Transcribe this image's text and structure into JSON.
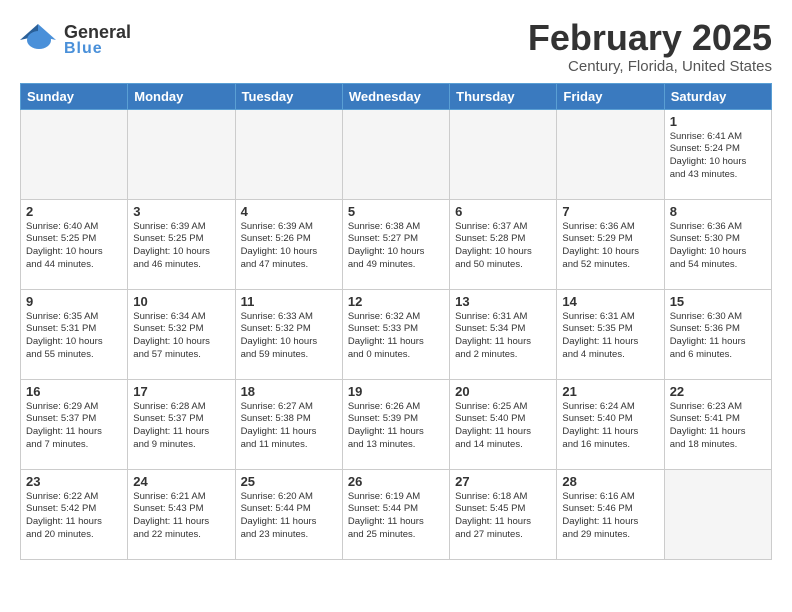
{
  "header": {
    "logo_general": "General",
    "logo_blue": "Blue",
    "month_title": "February 2025",
    "location": "Century, Florida, United States"
  },
  "days_of_week": [
    "Sunday",
    "Monday",
    "Tuesday",
    "Wednesday",
    "Thursday",
    "Friday",
    "Saturday"
  ],
  "weeks": [
    [
      {
        "day": "",
        "info": ""
      },
      {
        "day": "",
        "info": ""
      },
      {
        "day": "",
        "info": ""
      },
      {
        "day": "",
        "info": ""
      },
      {
        "day": "",
        "info": ""
      },
      {
        "day": "",
        "info": ""
      },
      {
        "day": "1",
        "info": "Sunrise: 6:41 AM\nSunset: 5:24 PM\nDaylight: 10 hours\nand 43 minutes."
      }
    ],
    [
      {
        "day": "2",
        "info": "Sunrise: 6:40 AM\nSunset: 5:25 PM\nDaylight: 10 hours\nand 44 minutes."
      },
      {
        "day": "3",
        "info": "Sunrise: 6:39 AM\nSunset: 5:25 PM\nDaylight: 10 hours\nand 46 minutes."
      },
      {
        "day": "4",
        "info": "Sunrise: 6:39 AM\nSunset: 5:26 PM\nDaylight: 10 hours\nand 47 minutes."
      },
      {
        "day": "5",
        "info": "Sunrise: 6:38 AM\nSunset: 5:27 PM\nDaylight: 10 hours\nand 49 minutes."
      },
      {
        "day": "6",
        "info": "Sunrise: 6:37 AM\nSunset: 5:28 PM\nDaylight: 10 hours\nand 50 minutes."
      },
      {
        "day": "7",
        "info": "Sunrise: 6:36 AM\nSunset: 5:29 PM\nDaylight: 10 hours\nand 52 minutes."
      },
      {
        "day": "8",
        "info": "Sunrise: 6:36 AM\nSunset: 5:30 PM\nDaylight: 10 hours\nand 54 minutes."
      }
    ],
    [
      {
        "day": "9",
        "info": "Sunrise: 6:35 AM\nSunset: 5:31 PM\nDaylight: 10 hours\nand 55 minutes."
      },
      {
        "day": "10",
        "info": "Sunrise: 6:34 AM\nSunset: 5:32 PM\nDaylight: 10 hours\nand 57 minutes."
      },
      {
        "day": "11",
        "info": "Sunrise: 6:33 AM\nSunset: 5:32 PM\nDaylight: 10 hours\nand 59 minutes."
      },
      {
        "day": "12",
        "info": "Sunrise: 6:32 AM\nSunset: 5:33 PM\nDaylight: 11 hours\nand 0 minutes."
      },
      {
        "day": "13",
        "info": "Sunrise: 6:31 AM\nSunset: 5:34 PM\nDaylight: 11 hours\nand 2 minutes."
      },
      {
        "day": "14",
        "info": "Sunrise: 6:31 AM\nSunset: 5:35 PM\nDaylight: 11 hours\nand 4 minutes."
      },
      {
        "day": "15",
        "info": "Sunrise: 6:30 AM\nSunset: 5:36 PM\nDaylight: 11 hours\nand 6 minutes."
      }
    ],
    [
      {
        "day": "16",
        "info": "Sunrise: 6:29 AM\nSunset: 5:37 PM\nDaylight: 11 hours\nand 7 minutes."
      },
      {
        "day": "17",
        "info": "Sunrise: 6:28 AM\nSunset: 5:37 PM\nDaylight: 11 hours\nand 9 minutes."
      },
      {
        "day": "18",
        "info": "Sunrise: 6:27 AM\nSunset: 5:38 PM\nDaylight: 11 hours\nand 11 minutes."
      },
      {
        "day": "19",
        "info": "Sunrise: 6:26 AM\nSunset: 5:39 PM\nDaylight: 11 hours\nand 13 minutes."
      },
      {
        "day": "20",
        "info": "Sunrise: 6:25 AM\nSunset: 5:40 PM\nDaylight: 11 hours\nand 14 minutes."
      },
      {
        "day": "21",
        "info": "Sunrise: 6:24 AM\nSunset: 5:40 PM\nDaylight: 11 hours\nand 16 minutes."
      },
      {
        "day": "22",
        "info": "Sunrise: 6:23 AM\nSunset: 5:41 PM\nDaylight: 11 hours\nand 18 minutes."
      }
    ],
    [
      {
        "day": "23",
        "info": "Sunrise: 6:22 AM\nSunset: 5:42 PM\nDaylight: 11 hours\nand 20 minutes."
      },
      {
        "day": "24",
        "info": "Sunrise: 6:21 AM\nSunset: 5:43 PM\nDaylight: 11 hours\nand 22 minutes."
      },
      {
        "day": "25",
        "info": "Sunrise: 6:20 AM\nSunset: 5:44 PM\nDaylight: 11 hours\nand 23 minutes."
      },
      {
        "day": "26",
        "info": "Sunrise: 6:19 AM\nSunset: 5:44 PM\nDaylight: 11 hours\nand 25 minutes."
      },
      {
        "day": "27",
        "info": "Sunrise: 6:18 AM\nSunset: 5:45 PM\nDaylight: 11 hours\nand 27 minutes."
      },
      {
        "day": "28",
        "info": "Sunrise: 6:16 AM\nSunset: 5:46 PM\nDaylight: 11 hours\nand 29 minutes."
      },
      {
        "day": "",
        "info": ""
      }
    ]
  ]
}
